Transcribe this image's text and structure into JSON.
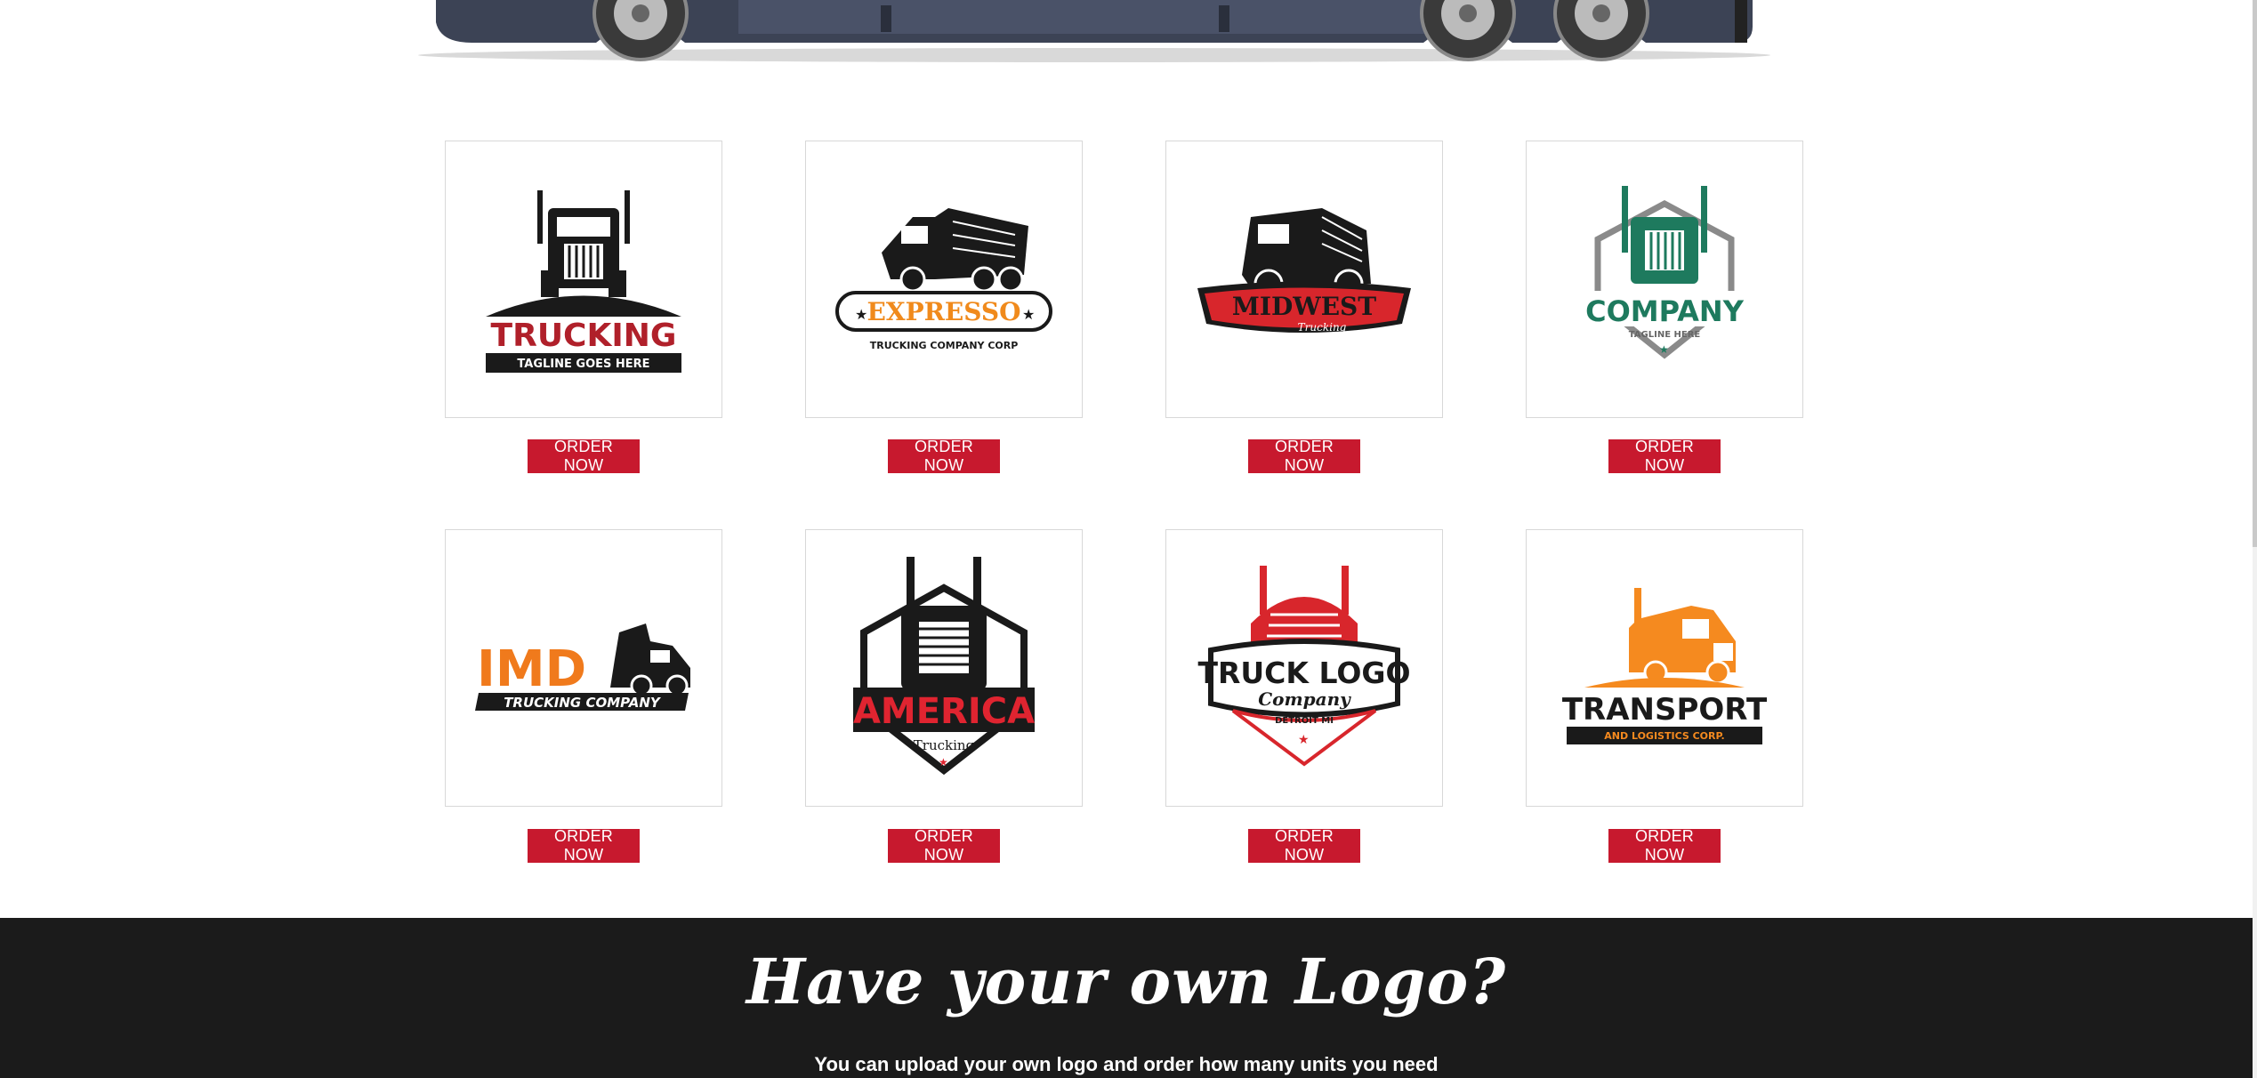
{
  "logos": [
    {
      "name": "TRUCKING",
      "tagline": "TAGLINE GOES HERE",
      "button": "ORDER NOW"
    },
    {
      "name": "EXPRESSO",
      "tagline": "TRUCKING COMPANY CORP",
      "button": "ORDER NOW"
    },
    {
      "name": "MIDWEST",
      "tagline": "Trucking",
      "button": "ORDER NOW"
    },
    {
      "name": "COMPANY",
      "tagline": "TAGLINE HERE",
      "button": "ORDER NOW"
    },
    {
      "name": "IMD",
      "tagline": "TRUCKING COMPANY",
      "button": "ORDER NOW"
    },
    {
      "name": "AMERICA",
      "tagline": "Trucking",
      "button": "ORDER NOW"
    },
    {
      "name": "TRUCK LOGO",
      "tagline": "Company",
      "location": "DETROIT MI",
      "button": "ORDER NOW"
    },
    {
      "name": "TRANSPORT",
      "tagline": "AND LOGISTICS CORP.",
      "button": "ORDER NOW"
    }
  ],
  "own_logo": {
    "heading": "Have your own  Logo?",
    "text": "You can upload your own logo and order how many units you need"
  },
  "colors": {
    "button": "#c7192e",
    "footer_bg": "#1b1b1b"
  }
}
